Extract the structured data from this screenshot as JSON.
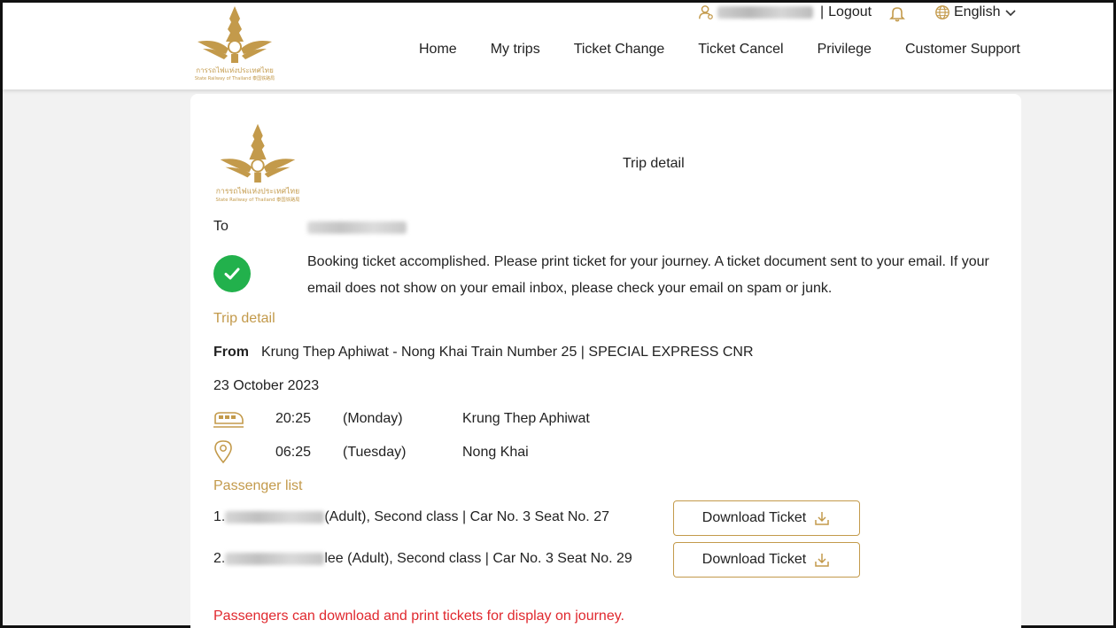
{
  "header": {
    "logo_text_th": "การรถไฟแห่งประเทศไทย",
    "logo_text_en": "State Railway of Thailand 泰国铁路局",
    "logout_label": "Logout",
    "language_label": "English",
    "nav": [
      "Home",
      "My trips",
      "Ticket Change",
      "Ticket Cancel",
      "Privilege",
      "Customer Support"
    ]
  },
  "card": {
    "title": "Trip detail",
    "to_label": "To",
    "message": "Booking ticket accomplished. Please print ticket for your journey. A ticket document sent to your email. If your email does not show on your email inbox, please check your email on spam or junk.",
    "trip_section": "Trip detail",
    "from_label": "From",
    "route": "Krung Thep Aphiwat - Nong Khai Train Number 25 | SPECIAL EXPRESS CNR",
    "date": "23 October 2023",
    "departure": {
      "time": "20:25",
      "day": "(Monday)",
      "station": "Krung Thep Aphiwat"
    },
    "arrival": {
      "time": "06:25",
      "day": "(Tuesday)",
      "station": "Nong Khai"
    },
    "passenger_section": "Passenger list",
    "passengers": [
      {
        "prefix": "1.",
        "details": "(Adult), Second class | Car No. 3 Seat No. 27"
      },
      {
        "prefix": "2.",
        "details": "lee (Adult), Second class | Car No. 3 Seat No. 29"
      }
    ],
    "download_label": "Download Ticket",
    "note": "Passengers can download and print tickets for display on journey."
  },
  "colors": {
    "gold": "#c39a4b",
    "success": "#22b14c",
    "warning": "#e0282e"
  }
}
